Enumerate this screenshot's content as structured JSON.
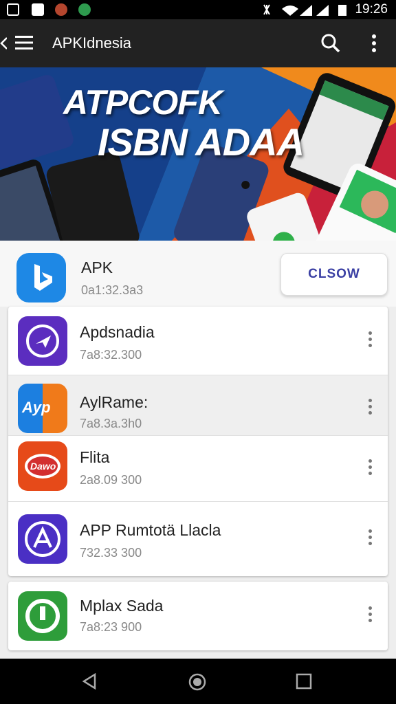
{
  "status_bar": {
    "time": "19:26"
  },
  "app_bar": {
    "title": "APKIdnesia",
    "menu_icon": "hamburger-icon",
    "search_icon": "search-icon",
    "overflow_icon": "more-vert-icon"
  },
  "banner": {
    "line1": "ATPCOFK",
    "line2": "ISBN ADAA"
  },
  "featured": {
    "name": "APK",
    "meta": "0a1:32.3a3",
    "button_label": "CLSOW"
  },
  "apps": [
    {
      "name": "Apdsnadia",
      "meta": "7a8:32.300",
      "icon_text": ""
    },
    {
      "name": "AylRame:",
      "meta": "7a8.3a.3h0",
      "icon_text": "Ayp"
    },
    {
      "name": "Flita",
      "meta": "2a8.09 300",
      "icon_text": "Dawo"
    },
    {
      "name": "APP Rumtotä Llacla",
      "meta": "732.33 300",
      "icon_text": ""
    },
    {
      "name": "Mplax Sada",
      "meta": "7a8:23 900",
      "icon_text": ""
    }
  ],
  "colors": {
    "app_bar": "#222222",
    "accent": "#3a3fa3"
  }
}
